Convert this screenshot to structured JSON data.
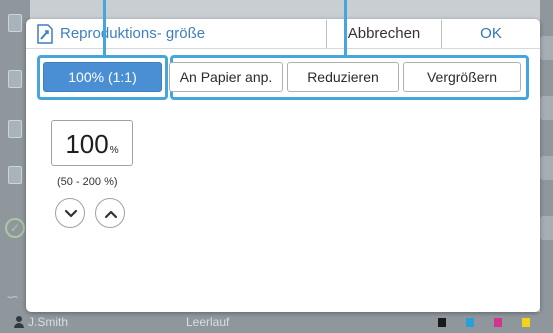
{
  "dialog": {
    "title": "Reproduktions- größe",
    "cancel_label": "Abbrechen",
    "ok_label": "OK"
  },
  "presets": [
    {
      "label": "100% (1:1)",
      "selected": true
    },
    {
      "label": "An Papier anp.",
      "selected": false
    },
    {
      "label": "Reduzieren",
      "selected": false
    },
    {
      "label": "Vergrößern",
      "selected": false
    }
  ],
  "ratio": {
    "value": "100",
    "unit": "%",
    "range": "(50 - 200 %)"
  },
  "statusbar": {
    "user": "J.Smith",
    "status": "Leerlauf"
  },
  "colors": {
    "accent": "#4a8fd4",
    "highlight": "#46a6dc",
    "title": "#3f7fbf"
  },
  "icons": {
    "title": "copy-size-icon",
    "decrease": "chevron-down-icon",
    "increase": "chevron-up-icon"
  }
}
